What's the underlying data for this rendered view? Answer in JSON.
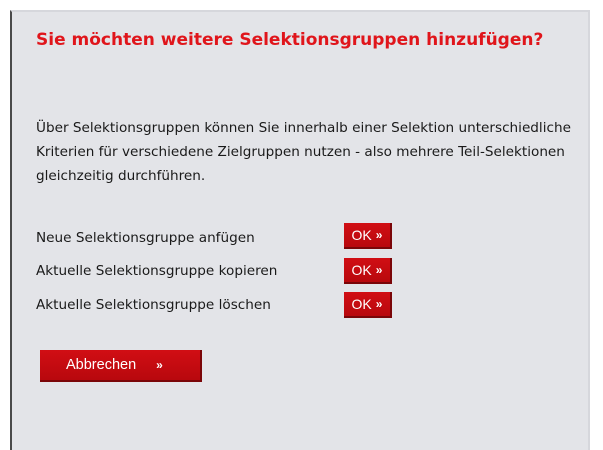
{
  "dialog": {
    "title": "Sie möchten weitere Selektionsgruppen hinzufügen?",
    "intro": "Über Selektionsgruppen können Sie innerhalb einer Selektion unterschiedliche Kriterien für verschiedene Zielgruppen nutzen - also mehrere Teil-Selektionen gleichzeitig durchführen.",
    "actions": [
      {
        "label": "Neue Selektionsgruppe anfügen",
        "button": "OK",
        "chevron": "»"
      },
      {
        "label": "Aktuelle Selektionsgruppe kopieren",
        "button": "OK",
        "chevron": "»"
      },
      {
        "label": "Aktuelle Selektionsgruppe löschen",
        "button": "OK",
        "chevron": "»"
      }
    ],
    "cancel": {
      "label": "Abbrechen",
      "chevron": "»"
    }
  },
  "colors": {
    "title": "#e0151b",
    "button": "#c80b11",
    "panel": "#e3e4e8"
  }
}
